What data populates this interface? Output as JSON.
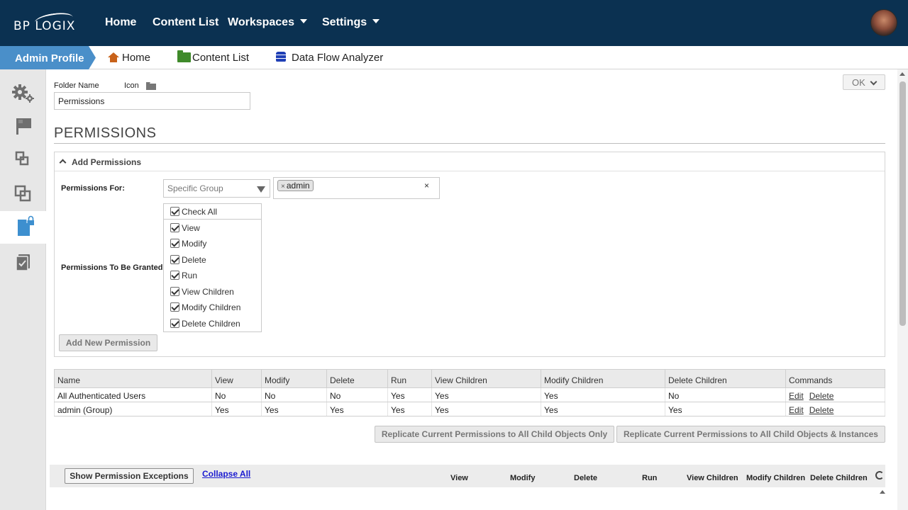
{
  "topbar": {
    "logo_text": "BP LOGIX",
    "nav": [
      {
        "label": "Home"
      },
      {
        "label": "Content List"
      },
      {
        "label": "Workspaces"
      },
      {
        "label": "Settings"
      }
    ]
  },
  "subbar": {
    "admin_profile": "Admin Profile",
    "links": [
      {
        "label": "Home",
        "icon": "home-icon",
        "color": "#c8621a"
      },
      {
        "label": "Content List",
        "icon": "folder-icon",
        "color": "#3f8a2a"
      },
      {
        "label": "Data Flow Analyzer",
        "icon": "database-icon",
        "color": "#1f3fb5"
      }
    ]
  },
  "sidebar": {
    "items": [
      {
        "icon": "gears-icon"
      },
      {
        "icon": "flag-icon"
      },
      {
        "icon": "workflow-icon"
      },
      {
        "icon": "copy-icon"
      },
      {
        "icon": "locked-document-icon",
        "active": true
      },
      {
        "icon": "checklist-icon"
      }
    ]
  },
  "form": {
    "folder_name_label": "Folder Name",
    "icon_label": "Icon",
    "folder_name_value": "Permissions",
    "ok_label": "OK"
  },
  "permissions": {
    "title": "PERMISSIONS",
    "add_panel_title": "Add Permissions",
    "for_label": "Permissions For:",
    "for_value": "Specific Group",
    "selected_tag": "admin",
    "tag_remove": "×",
    "tag_clear": "×",
    "granted_label": "Permissions To Be Granted",
    "checks": [
      "Check All",
      "View",
      "Modify",
      "Delete",
      "Run",
      "View Children",
      "Modify Children",
      "Delete Children"
    ],
    "add_button": "Add New Permission"
  },
  "table": {
    "headers": [
      "Name",
      "View",
      "Modify",
      "Delete",
      "Run",
      "View Children",
      "Modify Children",
      "Delete Children",
      "Commands"
    ],
    "rows": [
      [
        "All Authenticated Users",
        "No",
        "No",
        "No",
        "Yes",
        "Yes",
        "Yes",
        "No"
      ],
      [
        "admin (Group)",
        "Yes",
        "Yes",
        "Yes",
        "Yes",
        "Yes",
        "Yes",
        "Yes"
      ]
    ],
    "edit_label": "Edit",
    "delete_label": "Delete"
  },
  "replicate": {
    "child_only": "Replicate Current Permissions to All Child Objects Only",
    "child_instances": "Replicate Current Permissions to All Child Objects & Instances"
  },
  "exceptions": {
    "show_button": "Show Permission Exceptions",
    "collapse_all": "Collapse All",
    "columns": [
      "View",
      "Modify",
      "Delete",
      "Run",
      "View Children",
      "Modify Children",
      "Delete Children"
    ]
  }
}
